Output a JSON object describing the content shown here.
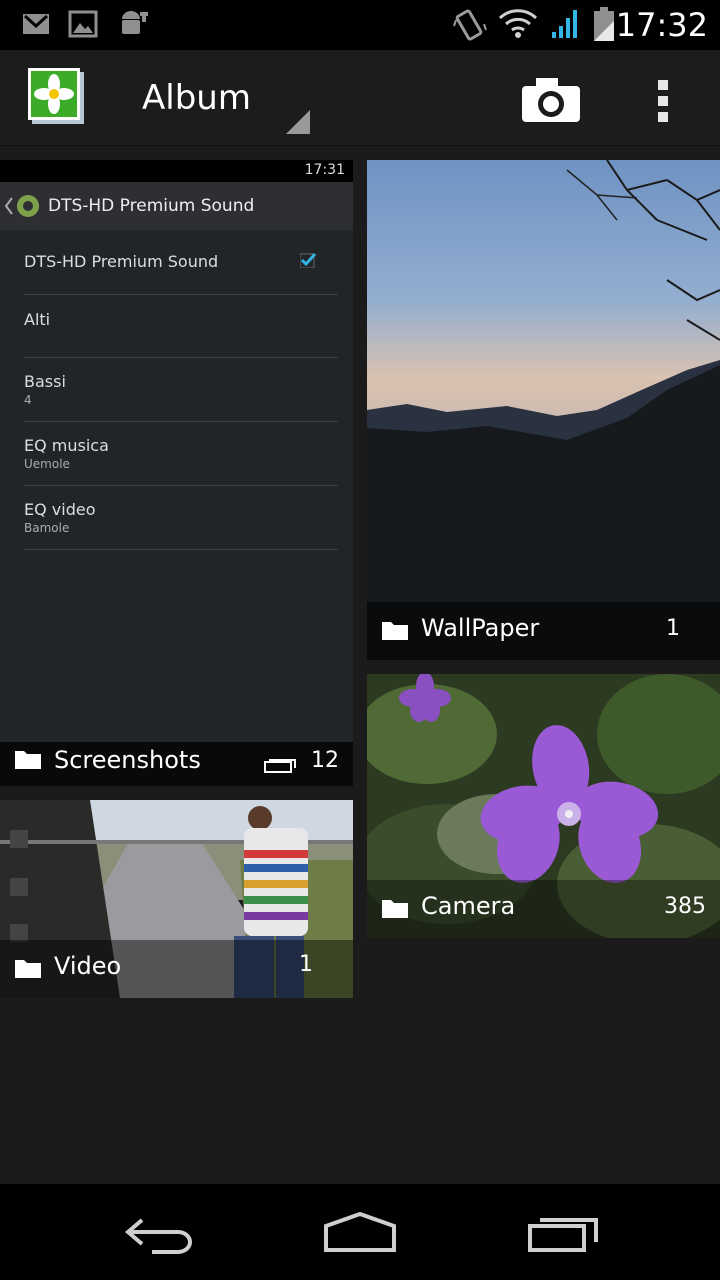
{
  "status": {
    "time": "17:32",
    "icons": [
      "gmail-icon",
      "image-notification-icon",
      "android-debug-icon",
      "vibrate-icon",
      "wifi-icon",
      "signal-icon",
      "battery-icon"
    ]
  },
  "actionbar": {
    "title": "Album",
    "icons": [
      "gallery-app-icon",
      "dropdown-triangle-icon",
      "camera-icon",
      "overflow-menu-icon"
    ]
  },
  "albums": [
    {
      "name": "Screenshots",
      "count": "12"
    },
    {
      "name": "WallPaper",
      "count": "1"
    },
    {
      "name": "Video",
      "count": "1"
    },
    {
      "name": "Camera",
      "count": "385"
    }
  ],
  "screenshot_preview": {
    "time": "17:31",
    "title": "DTS-HD Premium Sound",
    "rows": [
      {
        "label": "DTS-HD Premium Sound",
        "sub": ""
      },
      {
        "label": "Alti",
        "sub": ""
      },
      {
        "label": "Bassi",
        "sub": "4"
      },
      {
        "label": "EQ musica",
        "sub": "Uemole"
      },
      {
        "label": "EQ video",
        "sub": "Bamole"
      }
    ]
  },
  "colors": {
    "background": "#1b1b1b",
    "accent": "#33b5e5",
    "flower": "#8e44c9"
  },
  "navbar": {
    "icons": [
      "back-icon",
      "home-icon",
      "recents-icon"
    ]
  }
}
